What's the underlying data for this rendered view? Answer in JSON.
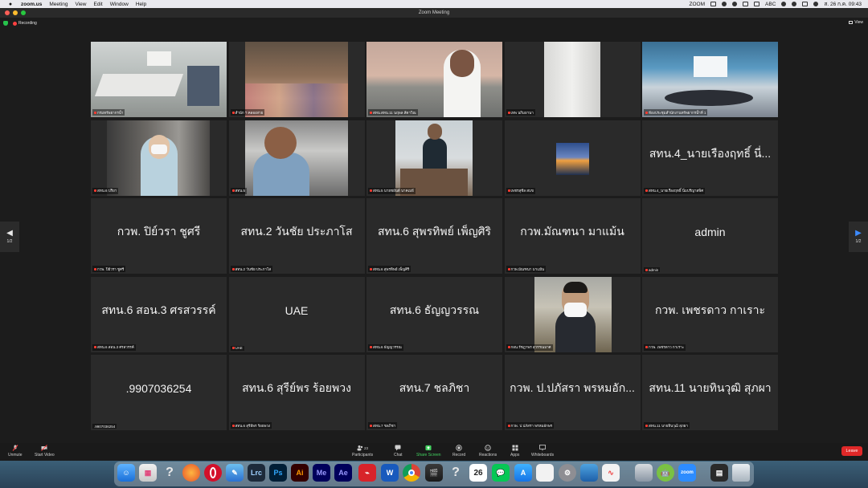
{
  "menubar": {
    "app": "zoom.us",
    "items": [
      "Meeting",
      "View",
      "Edit",
      "Window",
      "Help"
    ],
    "right_zoom": "ZOOM",
    "keyboard": "ABC",
    "clock": "ส. 26 ก.ค. 09:43"
  },
  "window": {
    "title": "Zoom Meeting"
  },
  "meeting": {
    "recording": "Recording",
    "view": "View"
  },
  "tiles": [
    {
      "name": "กรมทรัพยากรน้ำ"
    },
    {
      "name": "สำนัก ฯ คลองสาย"
    },
    {
      "name": "สทน.สทน.11 นฤพล สีดาวิณ"
    },
    {
      "name": "เทพ นกิมยานา"
    },
    {
      "name": "ห้องประชุมสำนักงานทรัพยากรน้ำที่ 1"
    },
    {
      "name": "สทน.6 ปริยา"
    },
    {
      "name": "สทน.5"
    },
    {
      "name": "สทน.5 นายชยันต์ นาคเมธี"
    },
    {
      "name": "เพชรสุชีล สบข"
    },
    {
      "display": "สทน.4_นายเรืองฤทธิ์ นี่...",
      "name": "สทน.4_นายเรืองฤทธิ์ นิ่มปรีญาสพิศ"
    },
    {
      "display": "กวพ. ปิย์วรา ชูศรี",
      "name": "กวพ. ปิย์วรา ชูศรี"
    },
    {
      "display": "สทน.2 วันชัย ประภาโส",
      "name": "สทน.2 วันชัย ประภาโส"
    },
    {
      "display": "สทน.6 สุพรทิพย์ เพ็ญศิริ",
      "name": "สทน.6 สุพรทิพย์ เพ็ญศิริ"
    },
    {
      "display": "กวพ.มัณฑนา มาแม้น",
      "name": "กวพ.มัณฑนา มาแม้น"
    },
    {
      "display": "admin",
      "name": "admin"
    },
    {
      "display": "สทน.6 สอน.3 ศรสวรรค์",
      "name": "สทน.6 สอน.3 ศรสวรรค์"
    },
    {
      "display": "UAE",
      "name": "UAE"
    },
    {
      "display": "สทน.6 ธัญญวรรณ",
      "name": "สทน.6 ธัญญวรรณ"
    },
    {
      "name": "กอน.รัชฎาพร สุวรรณมาศ"
    },
    {
      "display": "กวพ. เพชรดาว กาเราะ",
      "name": "กวพ. เพชรดาว กาเราะ"
    },
    {
      "display": ".9907036254",
      "name": ".9907036254"
    },
    {
      "display": "สทน.6 สุรีย์พร ร้อยพวง",
      "name": "สทน.6 สุรีย์พร ร้อยพวง"
    },
    {
      "display": "สทน.7 ชลภิชา",
      "name": "สทน.7 ชลภิชา"
    },
    {
      "display": "กวพ. ป.ปภัสรา พรหมอัก...",
      "name": "กวพ. ป.ปภัสรา พรหมอักษร"
    },
    {
      "display": "สทน.11 นายทินวุฒิ สุภผา",
      "name": "สทน.11 นายทินวุฒิ สุภผา"
    }
  ],
  "pager": {
    "left": "1/2",
    "right": "1/2"
  },
  "toolbar": {
    "unmute": "Unmute",
    "start_video": "Start Video",
    "participants": "Participants",
    "participants_count": "23",
    "chat": "Chat",
    "share": "Share Screen",
    "record": "Record",
    "reactions": "Reactions",
    "apps": "Apps",
    "whiteboards": "Whiteboards",
    "leave": "Leave"
  },
  "dock": {
    "lrc": "Lrc",
    "ps": "Ps",
    "ai": "Ai",
    "me": "Me",
    "ae": "Ae",
    "w": "W",
    "cal_day": "26",
    "zoom": "zoom",
    "help": "?"
  },
  "colors": {
    "active_outline": "#2fbf4b",
    "leave": "#e02828",
    "share": "#42d260",
    "tile_bg": "#2a2a2a"
  }
}
